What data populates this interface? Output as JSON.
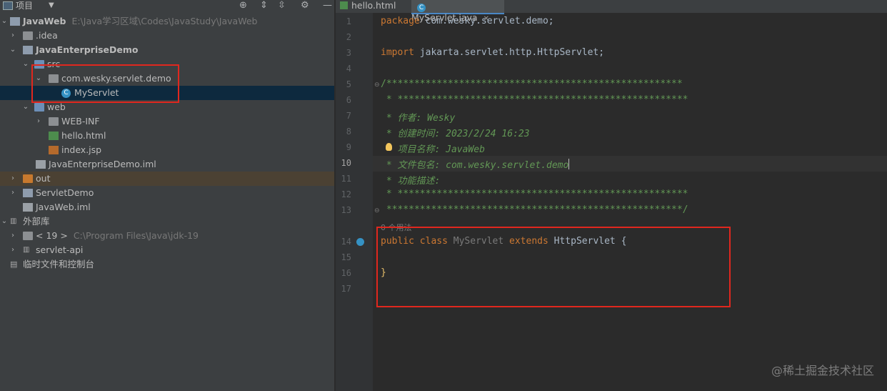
{
  "project_panel": {
    "title": "项目",
    "tree": [
      {
        "label": "JavaWeb",
        "path": "E:\\Java学习区域\\Codes\\JavaStudy\\JavaWeb"
      },
      {
        "label": ".idea"
      },
      {
        "label": "JavaEnterpriseDemo"
      },
      {
        "label": "src"
      },
      {
        "label": "com.wesky.servlet.demo"
      },
      {
        "label": "MyServlet"
      },
      {
        "label": "web"
      },
      {
        "label": "WEB-INF"
      },
      {
        "label": "hello.html"
      },
      {
        "label": "index.jsp"
      },
      {
        "label": "JavaEnterpriseDemo.iml"
      },
      {
        "label": "out"
      },
      {
        "label": "ServletDemo"
      },
      {
        "label": "JavaWeb.iml"
      },
      {
        "label": "外部库"
      },
      {
        "label": "< 19 >",
        "path": "C:\\Program Files\\Java\\jdk-19"
      },
      {
        "label": "servlet-api"
      },
      {
        "label": "临时文件和控制台"
      }
    ]
  },
  "tabs": [
    {
      "label": "hello.html"
    },
    {
      "label": "MyServlet.java"
    }
  ],
  "editor": {
    "line_numbers": [
      "1",
      "2",
      "3",
      "4",
      "5",
      "6",
      "7",
      "8",
      "9",
      "10",
      "11",
      "12",
      "13",
      "14",
      "15",
      "16",
      "17"
    ],
    "current_line": "10",
    "lines": {
      "l1": [
        "package",
        " com.wesky.servlet.demo;"
      ],
      "l3": [
        "import",
        " jakarta.servlet.http.HttpServlet;"
      ],
      "l5": "/*****************************************************",
      "l6": " * ****************************************************",
      "l7": [
        " * ",
        "作者",
        ": Wesky"
      ],
      "l8": [
        " * ",
        "创建时间",
        ": 2023/2/24 16:23"
      ],
      "l9": [
        " * ",
        "项目名称",
        ": JavaWeb"
      ],
      "l10": [
        " * ",
        "文件包名",
        ": com.wesky.servlet.demo"
      ],
      "l11": [
        " * ",
        "功能描述",
        ":"
      ],
      "l12": " * ****************************************************",
      "l13": " *****************************************************/",
      "usage_hint": "0 个用法",
      "l14": [
        "public",
        " ",
        "class",
        " MyServlet ",
        "extends",
        " HttpServlet {"
      ],
      "l16": "}"
    }
  },
  "watermark": "@稀土掘金技术社区",
  "colors": {
    "highlight_box": "#e0271e",
    "keyword": "#cc7832",
    "comment": "#629755",
    "selection": "#0d293e"
  }
}
